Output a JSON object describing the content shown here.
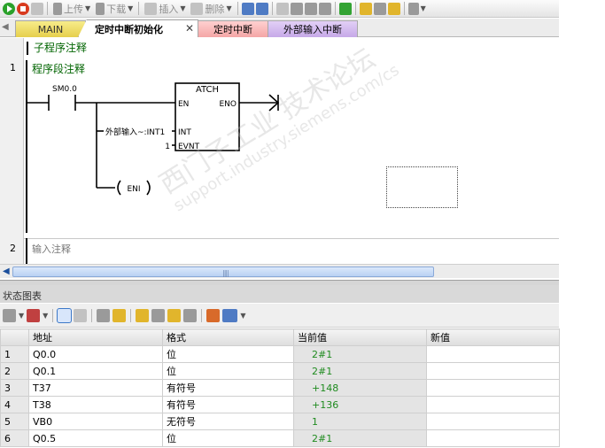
{
  "toolbar": {
    "upload_label": "上传",
    "download_label": "下载",
    "insert_label": "插入",
    "delete_label": "删除"
  },
  "tabs": {
    "main": "MAIN",
    "active": "定时中断初始化",
    "interrupt": "定时中断",
    "external": "外部输入中断"
  },
  "editor": {
    "sub_comment": "子程序注释",
    "network1": {
      "number": "1",
      "comment": "程序段注释",
      "contact_label": "SM0.0",
      "box_title": "ATCH",
      "pin_en": "EN",
      "pin_eno": "ENO",
      "pin_int": "INT",
      "pin_evnt": "EVNT",
      "int_operand": "外部输入~:INT1",
      "evnt_operand": "1",
      "coil_label": "ENI"
    },
    "network2": {
      "number": "2",
      "comment": "输入注释"
    }
  },
  "panel": {
    "title": "状态图表",
    "columns": [
      "",
      "地址",
      "格式",
      "当前值",
      "新值"
    ],
    "rows": [
      {
        "n": "1",
        "addr": "Q0.0",
        "fmt": "位",
        "cur": "2#1",
        "new": ""
      },
      {
        "n": "2",
        "addr": "Q0.1",
        "fmt": "位",
        "cur": "2#1",
        "new": ""
      },
      {
        "n": "3",
        "addr": "T37",
        "fmt": "有符号",
        "cur": "+148",
        "new": ""
      },
      {
        "n": "4",
        "addr": "T38",
        "fmt": "有符号",
        "cur": "+136",
        "new": ""
      },
      {
        "n": "5",
        "addr": "VB0",
        "fmt": "无符号",
        "cur": "1",
        "new": ""
      },
      {
        "n": "6",
        "addr": "Q0.5",
        "fmt": "位",
        "cur": "2#1",
        "new": ""
      }
    ]
  },
  "watermark": {
    "line1": "西门子工业 技术论坛",
    "line2": "support.industry.siemens.com/cs"
  }
}
